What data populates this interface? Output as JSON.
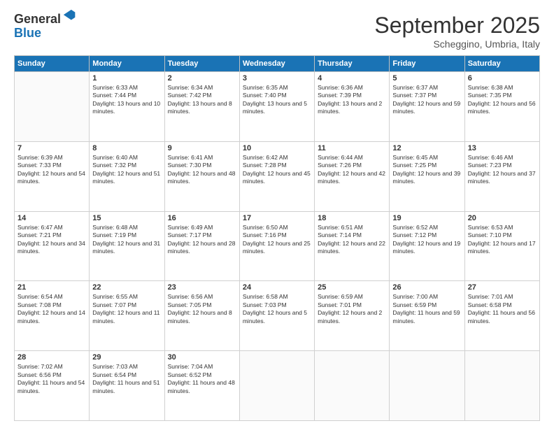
{
  "logo": {
    "general": "General",
    "blue": "Blue"
  },
  "title": "September 2025",
  "subtitle": "Scheggino, Umbria, Italy",
  "days_header": [
    "Sunday",
    "Monday",
    "Tuesday",
    "Wednesday",
    "Thursday",
    "Friday",
    "Saturday"
  ],
  "weeks": [
    [
      {
        "day": "",
        "sunrise": "",
        "sunset": "",
        "daylight": ""
      },
      {
        "day": "1",
        "sunrise": "Sunrise: 6:33 AM",
        "sunset": "Sunset: 7:44 PM",
        "daylight": "Daylight: 13 hours and 10 minutes."
      },
      {
        "day": "2",
        "sunrise": "Sunrise: 6:34 AM",
        "sunset": "Sunset: 7:42 PM",
        "daylight": "Daylight: 13 hours and 8 minutes."
      },
      {
        "day": "3",
        "sunrise": "Sunrise: 6:35 AM",
        "sunset": "Sunset: 7:40 PM",
        "daylight": "Daylight: 13 hours and 5 minutes."
      },
      {
        "day": "4",
        "sunrise": "Sunrise: 6:36 AM",
        "sunset": "Sunset: 7:39 PM",
        "daylight": "Daylight: 13 hours and 2 minutes."
      },
      {
        "day": "5",
        "sunrise": "Sunrise: 6:37 AM",
        "sunset": "Sunset: 7:37 PM",
        "daylight": "Daylight: 12 hours and 59 minutes."
      },
      {
        "day": "6",
        "sunrise": "Sunrise: 6:38 AM",
        "sunset": "Sunset: 7:35 PM",
        "daylight": "Daylight: 12 hours and 56 minutes."
      }
    ],
    [
      {
        "day": "7",
        "sunrise": "Sunrise: 6:39 AM",
        "sunset": "Sunset: 7:33 PM",
        "daylight": "Daylight: 12 hours and 54 minutes."
      },
      {
        "day": "8",
        "sunrise": "Sunrise: 6:40 AM",
        "sunset": "Sunset: 7:32 PM",
        "daylight": "Daylight: 12 hours and 51 minutes."
      },
      {
        "day": "9",
        "sunrise": "Sunrise: 6:41 AM",
        "sunset": "Sunset: 7:30 PM",
        "daylight": "Daylight: 12 hours and 48 minutes."
      },
      {
        "day": "10",
        "sunrise": "Sunrise: 6:42 AM",
        "sunset": "Sunset: 7:28 PM",
        "daylight": "Daylight: 12 hours and 45 minutes."
      },
      {
        "day": "11",
        "sunrise": "Sunrise: 6:44 AM",
        "sunset": "Sunset: 7:26 PM",
        "daylight": "Daylight: 12 hours and 42 minutes."
      },
      {
        "day": "12",
        "sunrise": "Sunrise: 6:45 AM",
        "sunset": "Sunset: 7:25 PM",
        "daylight": "Daylight: 12 hours and 39 minutes."
      },
      {
        "day": "13",
        "sunrise": "Sunrise: 6:46 AM",
        "sunset": "Sunset: 7:23 PM",
        "daylight": "Daylight: 12 hours and 37 minutes."
      }
    ],
    [
      {
        "day": "14",
        "sunrise": "Sunrise: 6:47 AM",
        "sunset": "Sunset: 7:21 PM",
        "daylight": "Daylight: 12 hours and 34 minutes."
      },
      {
        "day": "15",
        "sunrise": "Sunrise: 6:48 AM",
        "sunset": "Sunset: 7:19 PM",
        "daylight": "Daylight: 12 hours and 31 minutes."
      },
      {
        "day": "16",
        "sunrise": "Sunrise: 6:49 AM",
        "sunset": "Sunset: 7:17 PM",
        "daylight": "Daylight: 12 hours and 28 minutes."
      },
      {
        "day": "17",
        "sunrise": "Sunrise: 6:50 AM",
        "sunset": "Sunset: 7:16 PM",
        "daylight": "Daylight: 12 hours and 25 minutes."
      },
      {
        "day": "18",
        "sunrise": "Sunrise: 6:51 AM",
        "sunset": "Sunset: 7:14 PM",
        "daylight": "Daylight: 12 hours and 22 minutes."
      },
      {
        "day": "19",
        "sunrise": "Sunrise: 6:52 AM",
        "sunset": "Sunset: 7:12 PM",
        "daylight": "Daylight: 12 hours and 19 minutes."
      },
      {
        "day": "20",
        "sunrise": "Sunrise: 6:53 AM",
        "sunset": "Sunset: 7:10 PM",
        "daylight": "Daylight: 12 hours and 17 minutes."
      }
    ],
    [
      {
        "day": "21",
        "sunrise": "Sunrise: 6:54 AM",
        "sunset": "Sunset: 7:08 PM",
        "daylight": "Daylight: 12 hours and 14 minutes."
      },
      {
        "day": "22",
        "sunrise": "Sunrise: 6:55 AM",
        "sunset": "Sunset: 7:07 PM",
        "daylight": "Daylight: 12 hours and 11 minutes."
      },
      {
        "day": "23",
        "sunrise": "Sunrise: 6:56 AM",
        "sunset": "Sunset: 7:05 PM",
        "daylight": "Daylight: 12 hours and 8 minutes."
      },
      {
        "day": "24",
        "sunrise": "Sunrise: 6:58 AM",
        "sunset": "Sunset: 7:03 PM",
        "daylight": "Daylight: 12 hours and 5 minutes."
      },
      {
        "day": "25",
        "sunrise": "Sunrise: 6:59 AM",
        "sunset": "Sunset: 7:01 PM",
        "daylight": "Daylight: 12 hours and 2 minutes."
      },
      {
        "day": "26",
        "sunrise": "Sunrise: 7:00 AM",
        "sunset": "Sunset: 6:59 PM",
        "daylight": "Daylight: 11 hours and 59 minutes."
      },
      {
        "day": "27",
        "sunrise": "Sunrise: 7:01 AM",
        "sunset": "Sunset: 6:58 PM",
        "daylight": "Daylight: 11 hours and 56 minutes."
      }
    ],
    [
      {
        "day": "28",
        "sunrise": "Sunrise: 7:02 AM",
        "sunset": "Sunset: 6:56 PM",
        "daylight": "Daylight: 11 hours and 54 minutes."
      },
      {
        "day": "29",
        "sunrise": "Sunrise: 7:03 AM",
        "sunset": "Sunset: 6:54 PM",
        "daylight": "Daylight: 11 hours and 51 minutes."
      },
      {
        "day": "30",
        "sunrise": "Sunrise: 7:04 AM",
        "sunset": "Sunset: 6:52 PM",
        "daylight": "Daylight: 11 hours and 48 minutes."
      },
      {
        "day": "",
        "sunrise": "",
        "sunset": "",
        "daylight": ""
      },
      {
        "day": "",
        "sunrise": "",
        "sunset": "",
        "daylight": ""
      },
      {
        "day": "",
        "sunrise": "",
        "sunset": "",
        "daylight": ""
      },
      {
        "day": "",
        "sunrise": "",
        "sunset": "",
        "daylight": ""
      }
    ]
  ]
}
